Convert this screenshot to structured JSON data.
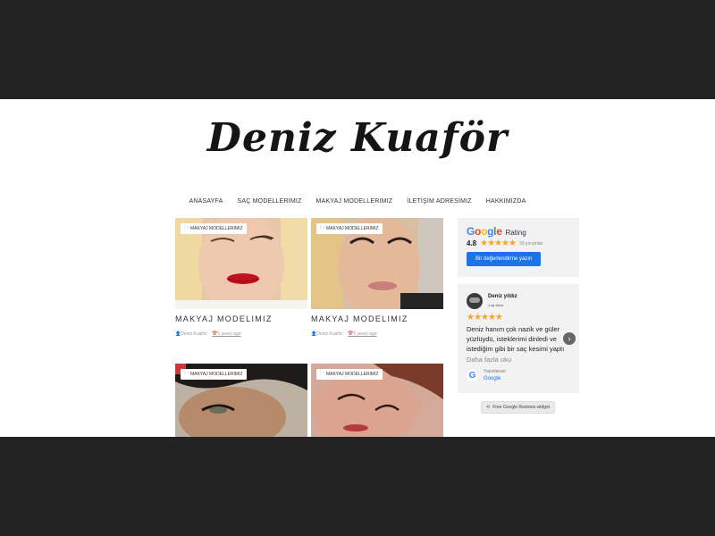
{
  "site": {
    "title": "Deniz Kuaför"
  },
  "nav": {
    "items": [
      "ANASAYFA",
      "SAÇ MODELLERIMIZ",
      "MAKYAJ MODELLERIMIZ",
      "İLETİŞİM ADRESİMIZ",
      "HAKKIMIZDA"
    ]
  },
  "posts": [
    {
      "category": "MAKYAJ MODELLERIMIZ",
      "title": "MAKYAJ MODELIMIZ",
      "author": "Deniz Kuaför",
      "date": "5 years ago"
    },
    {
      "category": "MAKYAJ MODELLERIMIZ",
      "title": "MAKYAJ MODELIMIZ",
      "author": "Deniz Kuaför",
      "date": "5 years ago"
    },
    {
      "category": "MAKYAJ MODELLERIMIZ"
    },
    {
      "category": "MAKYAJ MODELLERIMIZ"
    }
  ],
  "rating_widget": {
    "brand": "Google",
    "label": "Rating",
    "score": "4.8",
    "stars": "★★★★★",
    "count": "33 yorumlar",
    "button": "Bir değerlendirme yazın"
  },
  "review": {
    "author": "Deniz yıldız",
    "time": "1 ay önce",
    "stars": "★★★★★",
    "text": "Deniz hanım çok nazik ve güler yüzlüydü, isteklerimi dinledi ve istediğim gibi bir saç kesimi yaptı",
    "more": "Daha fazla oku",
    "posted_on_label": "Yayınlanan",
    "posted_on_source": "Google"
  },
  "free_widget": {
    "label": "Free Google Reviews widget"
  },
  "colors": {
    "accent": "#1a73e8",
    "star": "#f5a623",
    "background": "#222222"
  }
}
